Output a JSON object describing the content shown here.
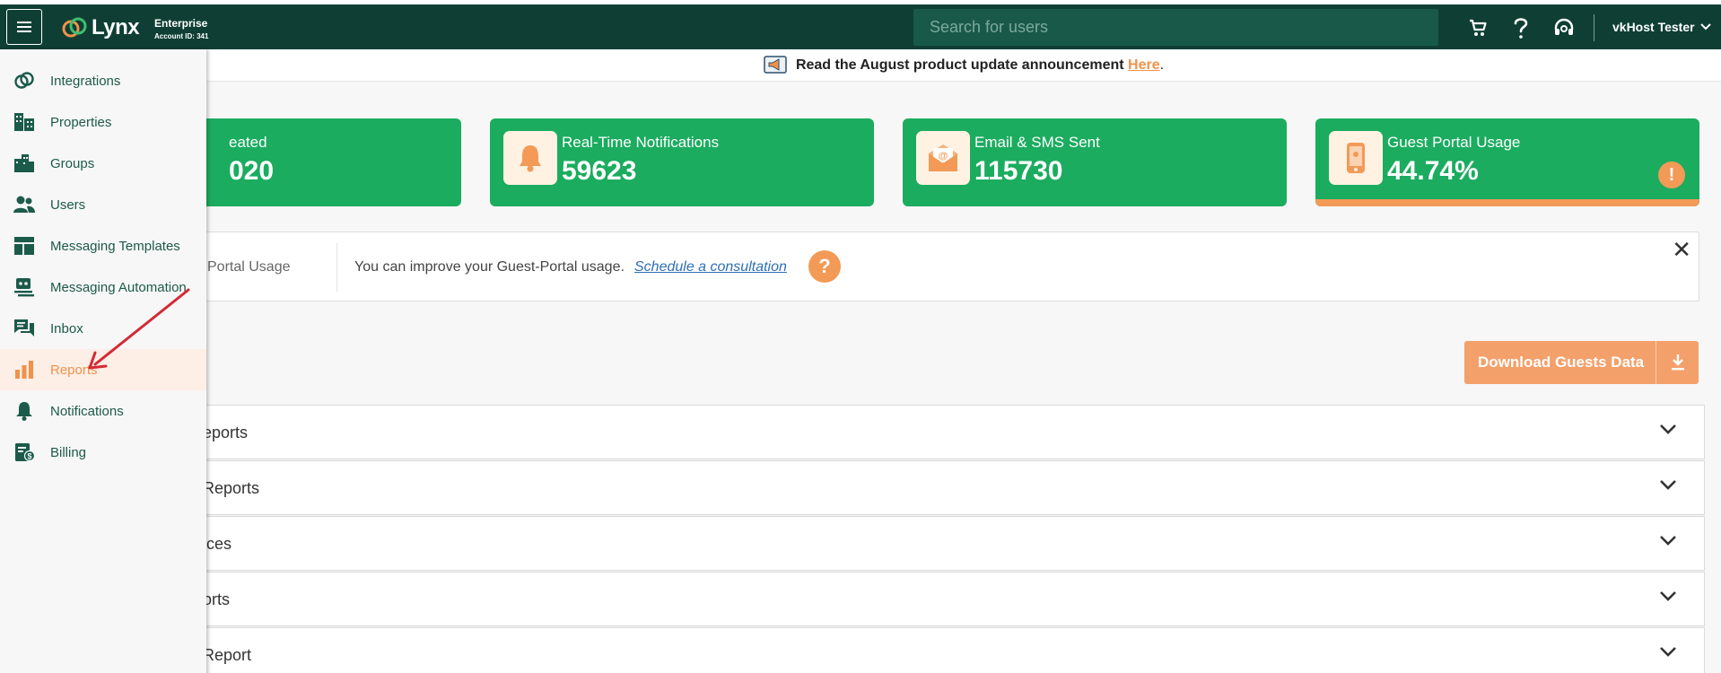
{
  "header": {
    "logo_text": "Lynx",
    "plan_name": "Enterprise",
    "account_label": "Account ID: 341",
    "search_placeholder": "Search for users",
    "user_name": "vkHost Tester"
  },
  "announcement": {
    "text": "Read the August product update announcement",
    "link": "Here",
    "trailing": "."
  },
  "stats": [
    {
      "label": "eated",
      "value": "020"
    },
    {
      "label": "Real-Time Notifications",
      "value": "59623"
    },
    {
      "label": "Email & SMS Sent",
      "value": "115730"
    },
    {
      "label": "Guest Portal Usage",
      "value": "44.74%"
    }
  ],
  "stats_alert_glyph": "!",
  "tip": {
    "label": "Portal Usage",
    "text": "You can improve your Guest-Portal usage.",
    "link": "Schedule a consultation",
    "help_glyph": "?",
    "close_glyph": "✕"
  },
  "download_label": "Download Guests Data",
  "accordion": [
    {
      "title": "eports"
    },
    {
      "title": "Reports"
    },
    {
      "title": "ices"
    },
    {
      "title": "orts"
    },
    {
      "title": "Report"
    }
  ],
  "sidebar": {
    "items": [
      {
        "label": "Integrations",
        "icon": "integrations-icon"
      },
      {
        "label": "Properties",
        "icon": "properties-icon"
      },
      {
        "label": "Groups",
        "icon": "groups-icon"
      },
      {
        "label": "Users",
        "icon": "users-icon"
      },
      {
        "label": "Messaging Templates",
        "icon": "templates-icon"
      },
      {
        "label": "Messaging Automation",
        "icon": "automation-icon"
      },
      {
        "label": "Inbox",
        "icon": "inbox-icon"
      },
      {
        "label": "Reports",
        "icon": "reports-icon",
        "active": true
      },
      {
        "label": "Notifications",
        "icon": "bell-icon"
      },
      {
        "label": "Billing",
        "icon": "billing-icon"
      }
    ]
  },
  "colors": {
    "topbar": "#0f3f34",
    "card_green": "#1bac5f",
    "accent_orange": "#f29a56",
    "nav_text": "#1c5a4a",
    "annotation_arrow": "#d42a35"
  }
}
